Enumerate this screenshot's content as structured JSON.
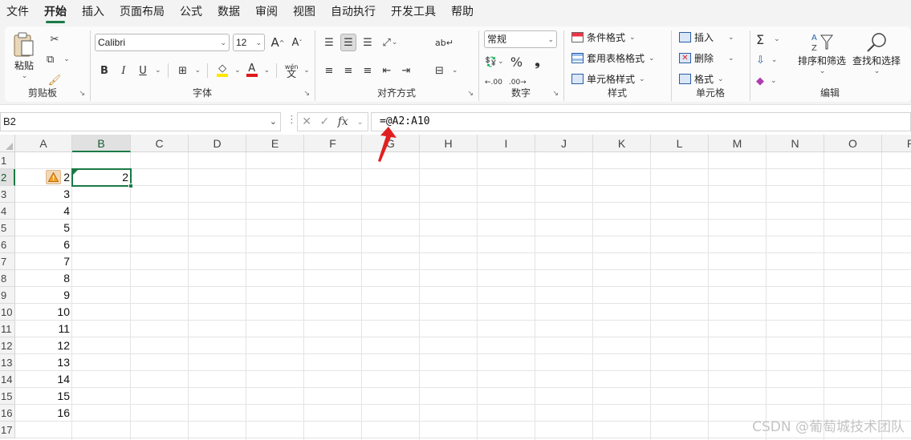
{
  "menu": {
    "tabs": [
      "文件",
      "开始",
      "插入",
      "页面布局",
      "公式",
      "数据",
      "审阅",
      "视图",
      "自动执行",
      "开发工具",
      "帮助"
    ],
    "active_tab": "开始"
  },
  "ribbon": {
    "clipboard": {
      "paste_label": "粘贴",
      "group_label": "剪贴板"
    },
    "font": {
      "font_name": "Calibri",
      "font_size": "12",
      "group_label": "字体",
      "bold": "B",
      "italic": "I",
      "underline": "U",
      "grow": "A",
      "shrink": "A",
      "phonetic": "wén"
    },
    "alignment": {
      "group_label": "对齐方式"
    },
    "number": {
      "format": "常规",
      "group_label": "数字"
    },
    "styles": {
      "conditional": "条件格式",
      "table": "套用表格格式",
      "cell_styles": "单元格样式",
      "group_label": "样式"
    },
    "cells": {
      "insert": "插入",
      "delete": "删除",
      "format": "格式",
      "group_label": "单元格"
    },
    "editing": {
      "sort_filter": "排序和筛选",
      "find_select": "查找和选择",
      "group_label": "编辑"
    }
  },
  "formula_bar": {
    "name_box": "B2",
    "fx_label": "fx",
    "formula": "=@A2:A10"
  },
  "sheet": {
    "columns": [
      "A",
      "B",
      "C",
      "D",
      "E",
      "F",
      "G",
      "H",
      "I",
      "J",
      "K",
      "L",
      "M",
      "N",
      "O",
      "P"
    ],
    "rows": [
      "1",
      "2",
      "3",
      "4",
      "5",
      "6",
      "7",
      "8",
      "9",
      "10",
      "11",
      "12",
      "13",
      "14",
      "15",
      "16",
      "17"
    ],
    "selected_column": "B",
    "selected_row": "2",
    "col_a_values": [
      "",
      "2",
      "3",
      "4",
      "5",
      "6",
      "7",
      "8",
      "9",
      "10",
      "11",
      "12",
      "13",
      "14",
      "15",
      "16",
      ""
    ],
    "b2_value": "2"
  },
  "watermark": "CSDN @葡萄城技术团队",
  "colors": {
    "accent": "#1a7a46",
    "arrow": "#e02020"
  }
}
